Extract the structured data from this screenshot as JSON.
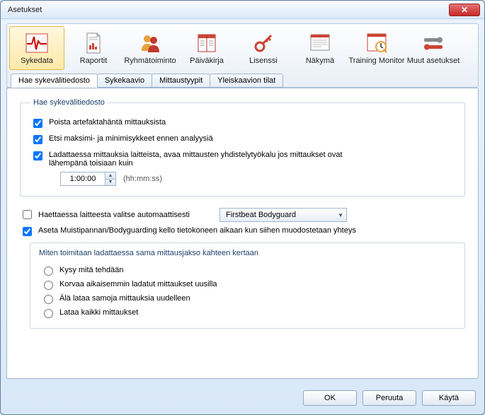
{
  "window": {
    "title": "Asetukset"
  },
  "toolbar": {
    "items": [
      {
        "label": "Sykedata"
      },
      {
        "label": "Raportit"
      },
      {
        "label": "Ryhmätoiminto"
      },
      {
        "label": "Päiväkirja"
      },
      {
        "label": "Lisenssi"
      },
      {
        "label": "Näkymä"
      },
      {
        "label": "Training Monitor"
      },
      {
        "label": "Muut asetukset"
      }
    ]
  },
  "tabs": {
    "items": [
      {
        "label": "Hae sykevälitiedosto"
      },
      {
        "label": "Sykekaavio"
      },
      {
        "label": "Mittaustyypit"
      },
      {
        "label": "Yleiskaavion tilat"
      }
    ]
  },
  "group1": {
    "legend": "Hae sykevälitiedosto",
    "chk1": "Poista artefaktahäntä mittauksista",
    "chk2": "Etsi maksimi- ja minimisykkeet ennen analyysiä",
    "chk3": "Ladattaessa mittauksia laitteista, avaa mittausten yhdistelytyökalu jos mittaukset ovat lähempänä toisiaan kuin",
    "time_value": "1:00:00",
    "time_hint": "(hh:mm:ss)"
  },
  "auto": {
    "chk": "Haettaessa laitteesta valitse automaattisesti",
    "combo_value": "Firstbeat Bodyguard"
  },
  "clock": {
    "chk": "Aseta Muistipannan/Bodyguarding kello tietokoneen aikaan kun siihen muodostetaan yhteys"
  },
  "subgroup": {
    "legend": "Miten toimitaan ladattaessa sama mittausjakso kahteen kertaan",
    "r1": "Kysy mitä tehdään",
    "r2": "Korvaa aikaisemmin ladatut mittaukset uusilla",
    "r3": "Älä lataa samoja mittauksia uudelleen",
    "r4": "Lataa kaikki mittaukset"
  },
  "buttons": {
    "ok": "OK",
    "cancel": "Peruuta",
    "apply": "Käytä"
  }
}
